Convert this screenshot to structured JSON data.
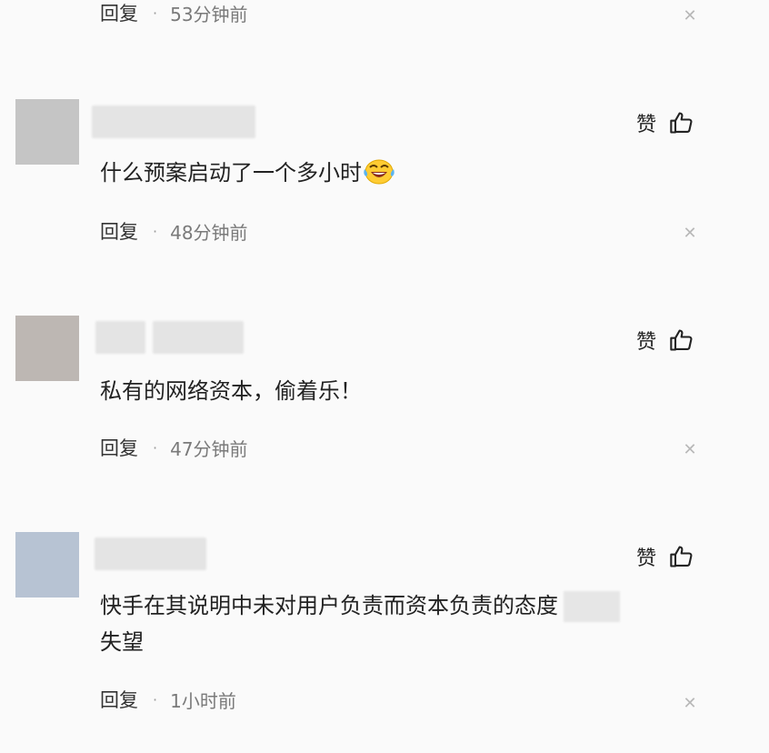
{
  "top_item": {
    "reply_label": "回复",
    "separator": "·",
    "time": "53分钟前",
    "close_icon": "close-icon"
  },
  "comments": [
    {
      "avatar_color": "#c5c5c5",
      "like_label": "赞",
      "text": "什么预案启动了一个多小时",
      "emoji": "laughing-crying-emoji",
      "reply_label": "回复",
      "separator": "·",
      "time": "48分钟前"
    },
    {
      "avatar_color": "#bdb7b3",
      "like_label": "赞",
      "text": "私有的网络资本，偷着乐！",
      "reply_label": "回复",
      "separator": "·",
      "time": "47分钟前"
    },
    {
      "avatar_color": "#b7c3d3",
      "like_label": "赞",
      "text_line1": "快手在其说明中未对用户负责而资本负责的态度",
      "text_line2": "失望",
      "reply_label": "回复",
      "separator": "·",
      "time": "1小时前"
    }
  ]
}
